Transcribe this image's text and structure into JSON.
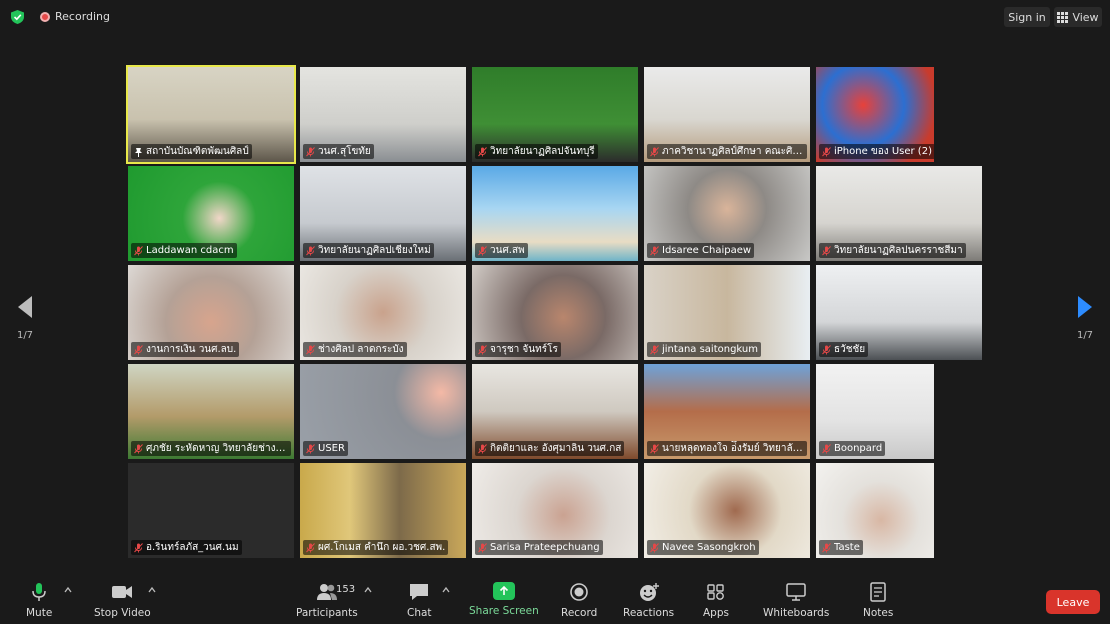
{
  "topbar": {
    "recording_label": "Recording",
    "signin_label": "Sign in",
    "view_label": "View"
  },
  "pager": {
    "left_text": "1/7",
    "right_text": "1/7"
  },
  "tiles": [
    {
      "name": "สถาบันบัณฑิตพัฒนศิลป์",
      "pinned": true
    },
    {
      "name": "วนศ.สุโขทัย"
    },
    {
      "name": "วิทยาลัยนาฏศิลปจันทบุรี"
    },
    {
      "name": "ภาควิชานาฏศิลป์ศึกษา คณะศิลปศึกษา"
    },
    {
      "name": "iPhone ของ User (2)"
    },
    {
      "name": "Laddawan cdacm"
    },
    {
      "name": "วิทยาลัยนาฏศิลปเชียงใหม่"
    },
    {
      "name": "วนศ.สพ"
    },
    {
      "name": "Idsaree Chaipaew"
    },
    {
      "name": "วิทยาลัยนาฏศิลปนครราชสีมา"
    },
    {
      "name": "งานการเงิน วนศ.ลบ."
    },
    {
      "name": "ช่างศิลป ลาดกระบัง"
    },
    {
      "name": "จารุชา จันทร์โร"
    },
    {
      "name": "jintana saitongkum"
    },
    {
      "name": "ธวัชชัย"
    },
    {
      "name": "ศุภชัย ระหัดหาญ วิทยาลัยช่างศิลปนครศรีธรรมราช"
    },
    {
      "name": "USER"
    },
    {
      "name": "กิตติยาและ อังศุมาลิน วนศ.กส"
    },
    {
      "name": "นายหลุดทองใจ อ่ึงรัมย์ วิทยาลัยนาฏศิลป"
    },
    {
      "name": "Boonpard"
    },
    {
      "name": "อ.รินทร์ลภัส_วนศ.นม"
    },
    {
      "name": "ผศ.โกเมส คำนึก ผอ.วชศ.สพ."
    },
    {
      "name": "Sarisa Prateepchuang"
    },
    {
      "name": "Navee Sasongkroh"
    },
    {
      "name": "Taste"
    }
  ],
  "toolbar": {
    "mute": "Mute",
    "stop_video": "Stop Video",
    "participants": "Participants",
    "participants_count": "153",
    "chat": "Chat",
    "share_screen": "Share Screen",
    "record": "Record",
    "reactions": "Reactions",
    "apps": "Apps",
    "whiteboards": "Whiteboards",
    "notes": "Notes",
    "leave": "Leave"
  },
  "colors": {
    "accent": "#2d8cff",
    "share": "#23c45a",
    "leave": "#d9342b",
    "active_speaker": "#e8e84a"
  }
}
